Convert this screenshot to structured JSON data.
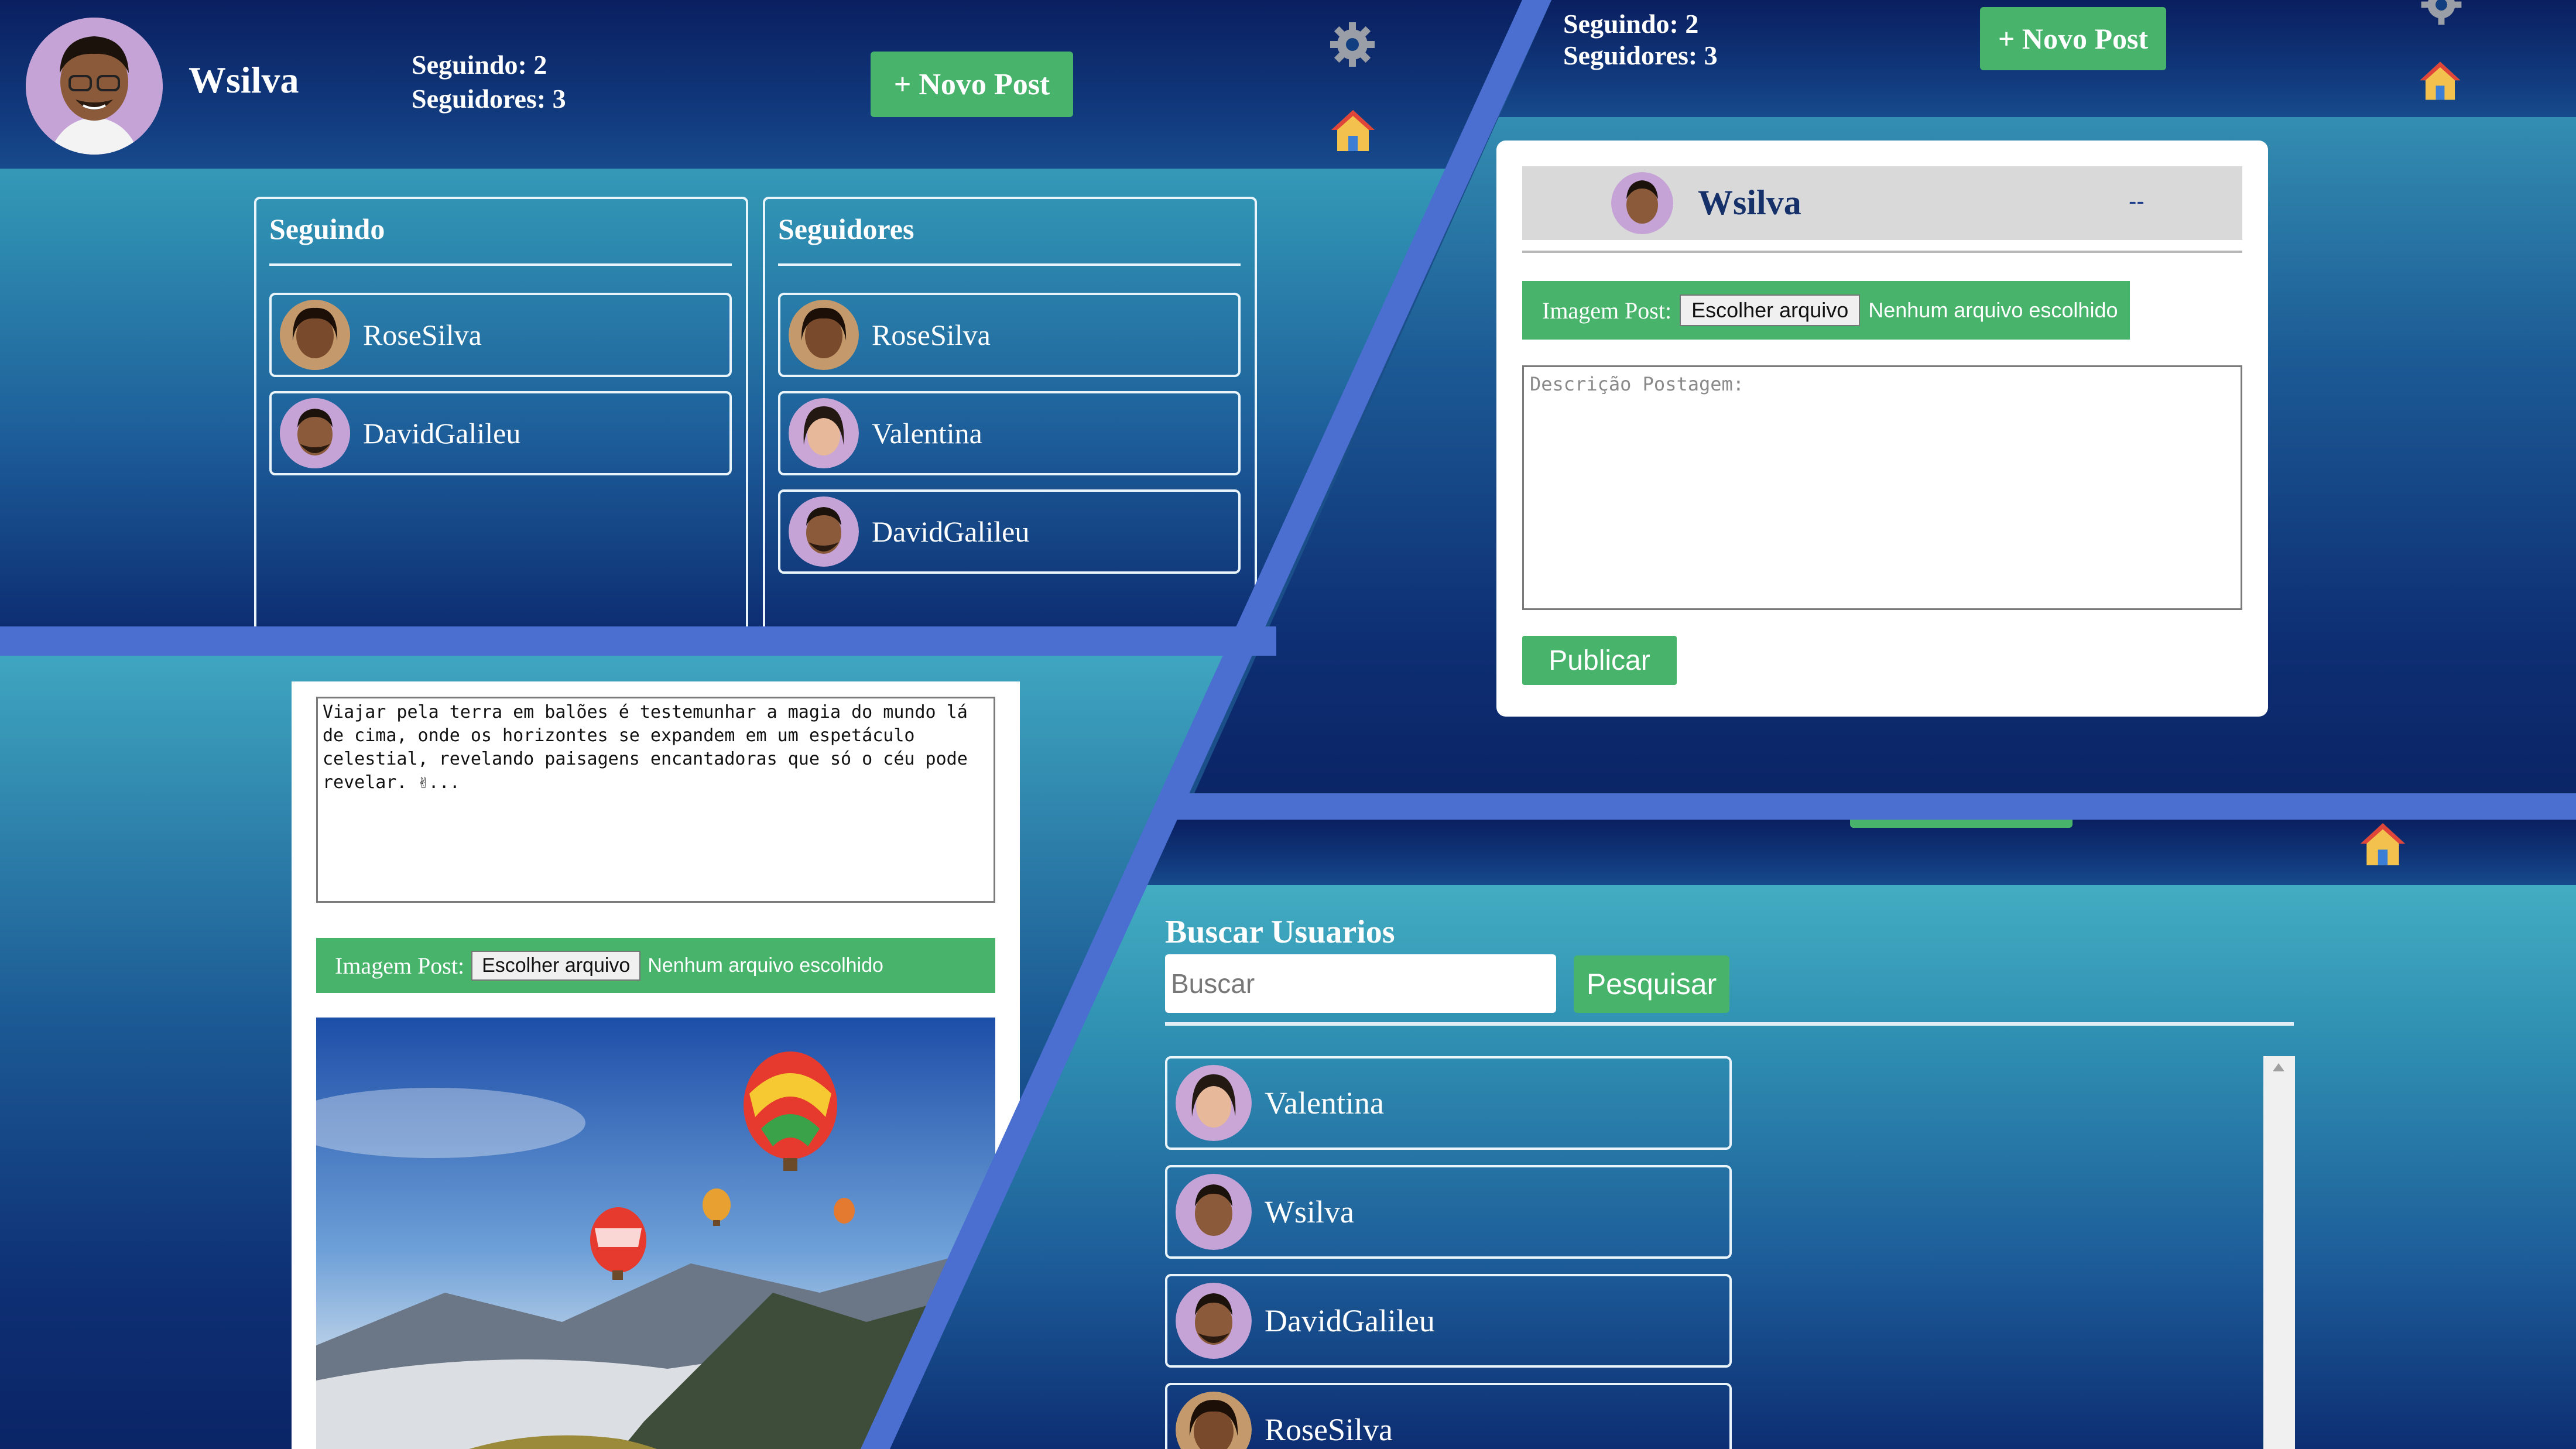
{
  "user": {
    "name": "Wsilva",
    "following_text": "Seguindo: 2",
    "followers_text": "Seguidores: 3"
  },
  "header": {
    "new_post_label": "+ Novo Post",
    "settings_icon": "gear-icon",
    "home_icon": "home-icon"
  },
  "following_panel": {
    "title": "Seguindo",
    "items": [
      "RoseSilva",
      "DavidGalileu"
    ]
  },
  "followers_panel": {
    "title": "Seguidores",
    "items": [
      "RoseSilva",
      "Valentina",
      "DavidGalileu"
    ]
  },
  "new_post_form": {
    "author": "Wsilva",
    "menu_text": "--",
    "image_label": "Imagem Post:",
    "file_button": "Escolher arquivo",
    "file_status": "Nenhum arquivo escolhido",
    "description_placeholder": "Descrição Postagem:",
    "publish_label": "Publicar"
  },
  "edit_post": {
    "text": "Viajar pela terra em balões é testemunhar a magia do mundo lá de cima, onde os horizontes se expandem em um espetáculo celestial, revelando paisagens encantadoras que só o céu pode revelar. ✌...",
    "image_label": "Imagem Post:",
    "file_button": "Escolher arquivo",
    "file_status": "Nenhum arquivo escolhido"
  },
  "search": {
    "title": "Buscar Usuarios",
    "placeholder": "Buscar",
    "button": "Pesquisar",
    "results": [
      "Valentina",
      "Wsilva",
      "DavidGalileu",
      "RoseSilva"
    ]
  },
  "colors": {
    "accent_green": "#48b36b",
    "header_dark": "#0a1f60",
    "divider_blue": "#4a6fd0"
  }
}
